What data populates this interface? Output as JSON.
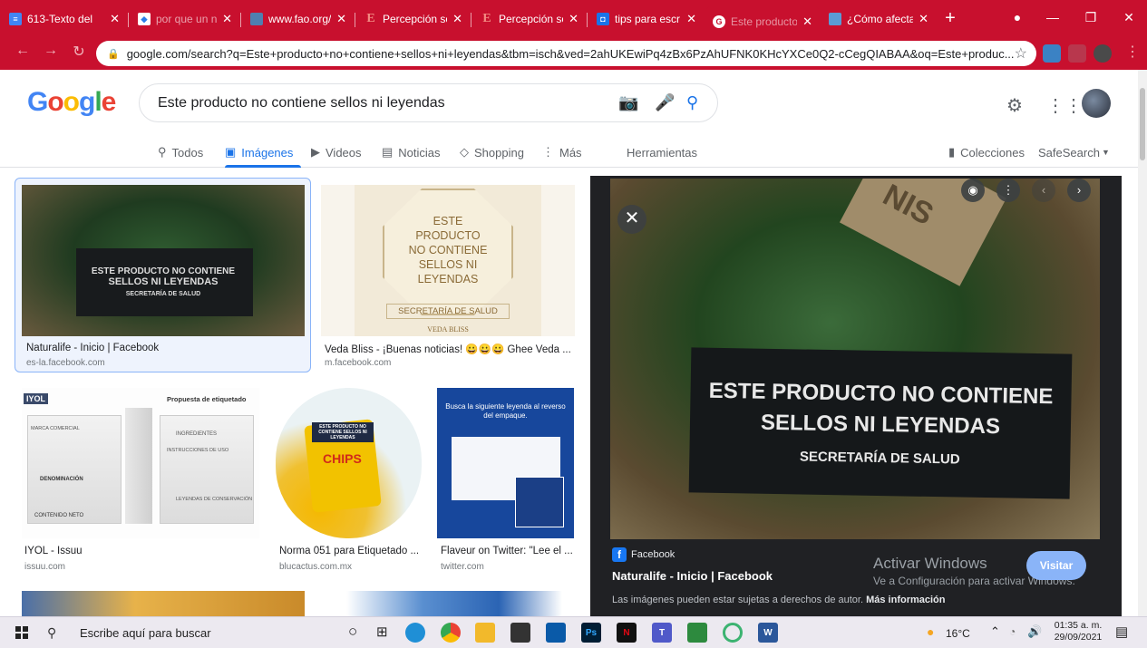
{
  "browser": {
    "tabs": [
      {
        "title": "613-Texto del",
        "icon_color": "#4285f4"
      },
      {
        "title": "por que un ni",
        "icon_color": "#2b7de9"
      },
      {
        "title": "www.fao.org/",
        "icon_color": "#4f7fb0"
      },
      {
        "title": "Percepción so",
        "icon_color": "#d9381e"
      },
      {
        "title": "Percepción so",
        "icon_color": "#d9381e"
      },
      {
        "title": "tips para escr",
        "icon_color": "#1a73e8"
      },
      {
        "title": "Este producto",
        "icon_color": "#ffffff"
      },
      {
        "title": "¿Cómo afecta",
        "icon_color": "#5b9bd5"
      }
    ],
    "url": "google.com/search?q=Este+producto+no+contiene+sellos+ni+leyendas&tbm=isch&ved=2ahUKEwiPq4zBx6PzAhUFNK0KHcYXCe0Q2-cCegQIABAA&oq=Este+produc...",
    "accent": "#c8102e"
  },
  "google": {
    "logo": "Google",
    "query": "Este producto no contiene sellos ni leyendas",
    "tabs": [
      {
        "label": "Todos",
        "icon": "🔍"
      },
      {
        "label": "Imágenes",
        "icon": "▣"
      },
      {
        "label": "Videos",
        "icon": "▶"
      },
      {
        "label": "Noticias",
        "icon": "▤"
      },
      {
        "label": "Shopping",
        "icon": "◇"
      },
      {
        "label": "Más",
        "icon": "⋮"
      }
    ],
    "tools": "Herramientas",
    "collections": "Colecciones",
    "safesearch": "SafeSearch"
  },
  "results": [
    {
      "title": "Naturalife - Inicio | Facebook",
      "source": "es-la.facebook.com",
      "img_text": [
        "ESTE PRODUCTO NO CONTIENE",
        "SELLOS NI LEYENDAS",
        "SECRETARÍA DE SALUD"
      ]
    },
    {
      "title": "Veda Bliss - ¡Buenas noticias! 😀😀😀 Ghee Veda ...",
      "source": "m.facebook.com",
      "img_text": [
        "ESTE",
        "PRODUCTO",
        "NO CONTIENE",
        "SELLOS NI",
        "LEYENDAS",
        "SECRETARÍA DE SALUD",
        "VEDA BLISS"
      ]
    },
    {
      "title": "IYOL - Issuu",
      "source": "issuu.com",
      "img_text": [
        "IYOL",
        "Propuesta de etiquetado",
        "MARCA COMERCIAL",
        "INGREDIENTES",
        "INSTRUCCIONES DE USO",
        "DENOMINACIÓN",
        "LEYENDAS DE CONSERVACIÓN",
        "CONTENIDO NETO"
      ]
    },
    {
      "title": "Norma 051 para Etiquetado ...",
      "source": "blucactus.com.mx",
      "img_text": [
        "ESTE PRODUCTO NO CONTIENE SELLOS NI LEYENDAS",
        "CHIPS"
      ]
    },
    {
      "title": "Flaveur on Twitter: \"Lee el ...",
      "source": "twitter.com",
      "img_text": [
        "Busca la siguiente leyenda al reverso del empaque."
      ]
    }
  ],
  "preview": {
    "label_lines": [
      "ESTE PRODUCTO NO CONTIENE",
      "SELLOS NI LEYENDAS",
      "SECRETARÍA DE SALUD"
    ],
    "source": "Facebook",
    "title": "Naturalife - Inicio | Facebook",
    "copyright": "Las imágenes pueden estar sujetas a derechos de autor.",
    "more_info": "Más información",
    "visit": "Visitar",
    "watermark_title": "Activar Windows",
    "watermark_sub": "Ve a Configuración para activar Windows."
  },
  "taskbar": {
    "search_placeholder": "Escribe aquí para buscar",
    "weather": "16°C",
    "time": "01:35 a. m.",
    "date": "29/09/2021"
  }
}
